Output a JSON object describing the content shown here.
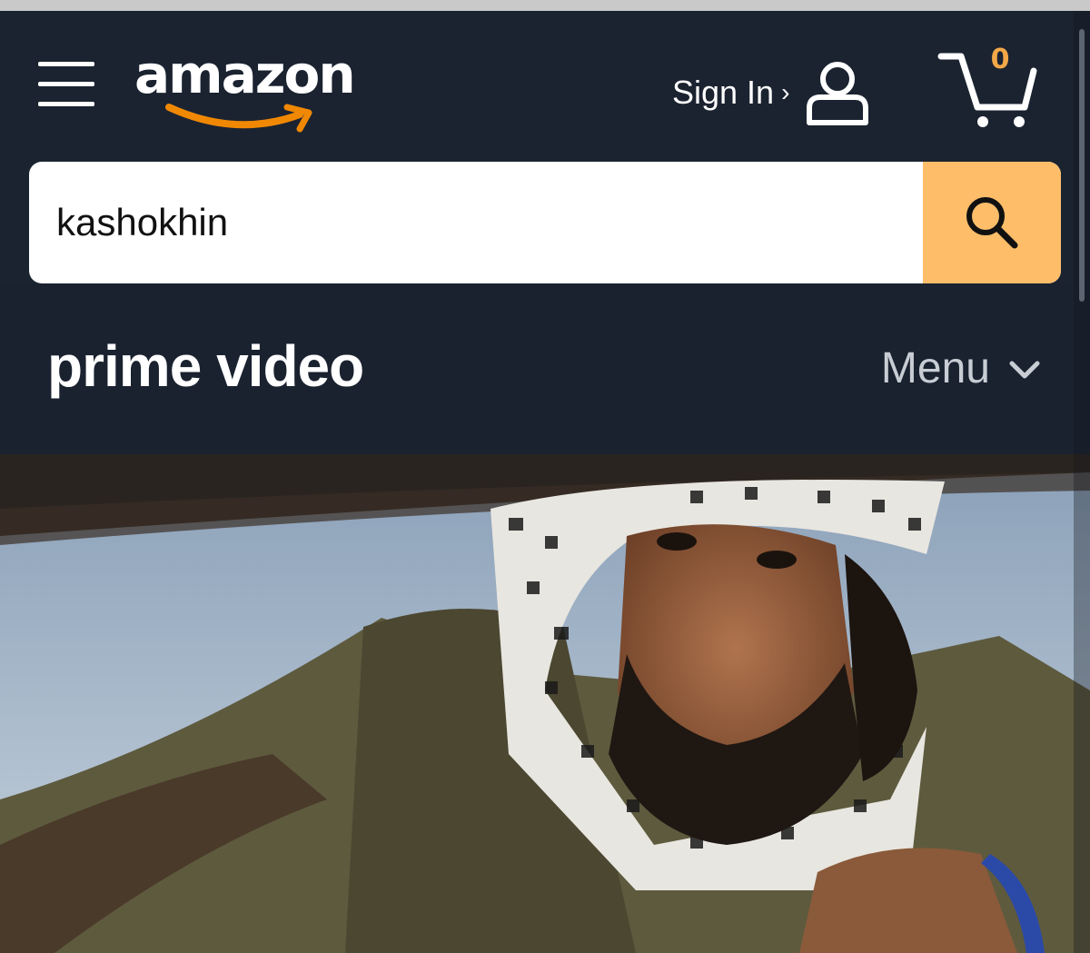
{
  "header": {
    "logo_text": "amazon",
    "sign_in_label": "Sign In",
    "sign_in_chevron": "›",
    "cart_count": "0",
    "icons": {
      "menu": "hamburger-menu-icon",
      "account": "user-icon",
      "cart": "cart-icon",
      "search": "search-icon"
    }
  },
  "search": {
    "value": "kashokhin",
    "placeholder": ""
  },
  "prime_video": {
    "logo_text": "prime video",
    "menu_label": "Menu",
    "menu_icon": "chevron-down-icon"
  },
  "colors": {
    "nav_bg": "#1b2331",
    "accent_orange": "#febd69",
    "cart_count": "#f3a847",
    "smile_orange": "#f08804"
  }
}
